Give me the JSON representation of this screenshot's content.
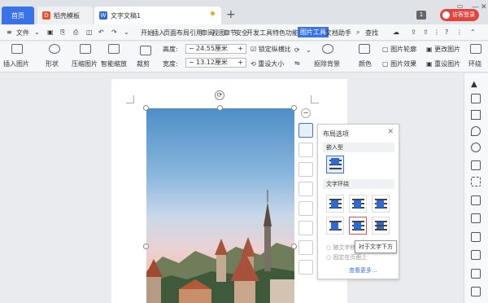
{
  "tabs": {
    "home": "首页",
    "template": "稻壳模板",
    "doc": "文字文稿1"
  },
  "window": {
    "page_num": "1",
    "visitor": "访客登录"
  },
  "menu": {
    "file": "文件",
    "items": [
      "开始",
      "插入",
      "页面布局",
      "引用",
      "审阅",
      "视图",
      "章节",
      "安全",
      "开发工具",
      "特色功能"
    ],
    "picture_tools": "图片工具",
    "doc_helper": "文档助手",
    "search": "查找"
  },
  "ribbon": {
    "insert_picture": "插入图片",
    "shape": "形状",
    "compress": "压缩图片",
    "smart_scale": "智能缩放",
    "crop": "裁剪",
    "height_label": "高度:",
    "height_value": "24.55厘米",
    "width_label": "宽度:",
    "width_value": "13.12厘米",
    "lock_ratio": "锁定纵横比",
    "reset_size": "重设大小",
    "remove_bg": "抠除背景",
    "color": "颜色",
    "outline": "图片轮廓",
    "effect": "图片效果",
    "change_pic": "更改图片",
    "reset_pic": "重设图片",
    "wrap": "环绕"
  },
  "panel": {
    "title": "布局选项",
    "inline_section": "嵌入型",
    "wrap_section": "文字环绕",
    "move_with_text": "随文字移动",
    "fixed_on_page": "固定在页面上",
    "see_more": "查看更多..."
  },
  "tooltip": "衬于文字下方",
  "colors": {
    "accent": "#3a72e8",
    "visitor": "#e0463f"
  }
}
